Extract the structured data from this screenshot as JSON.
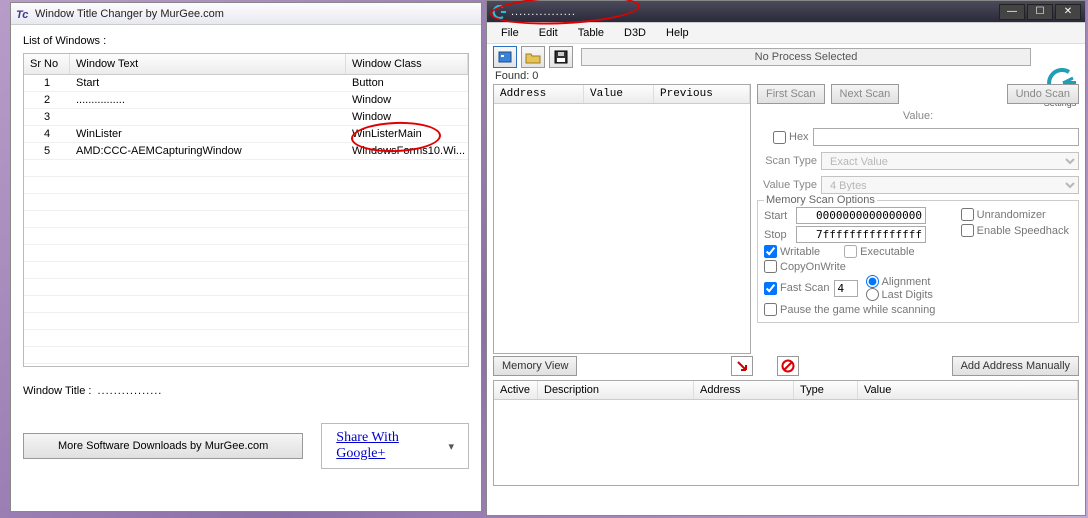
{
  "left": {
    "title": "Window Title Changer by MurGee.com",
    "listLabel": "List of Windows :",
    "headers": {
      "sr": "Sr No",
      "text": "Window Text",
      "cls": "Window Class"
    },
    "rows": [
      {
        "sr": "1",
        "text": "Start",
        "cls": "Button"
      },
      {
        "sr": "2",
        "text": "................",
        "cls": "Window"
      },
      {
        "sr": "3",
        "text": "",
        "cls": "Window"
      },
      {
        "sr": "4",
        "text": "WinLister",
        "cls": "WinListerMain"
      },
      {
        "sr": "5",
        "text": "AMD:CCC-AEMCapturingWindow",
        "cls": "WindowsForms10.Wi..."
      }
    ],
    "windowTitleLabel": "Window Title :",
    "windowTitleValue": "................",
    "moreBtn": "More Software Downloads by MurGee.com",
    "shareLink": "Share With Google+"
  },
  "right": {
    "title": "................",
    "menu": {
      "file": "File",
      "edit": "Edit",
      "table": "Table",
      "d3d": "D3D",
      "help": "Help"
    },
    "process": "No Process Selected",
    "settings": "Settings",
    "found": "Found: 0",
    "scanHead": {
      "addr": "Address",
      "val": "Value",
      "prev": "Previous"
    },
    "buttons": {
      "first": "First Scan",
      "next": "Next Scan",
      "undo": "Undo Scan",
      "memview": "Memory View",
      "addman": "Add Address Manually"
    },
    "labels": {
      "value": "Value:",
      "hex": "Hex",
      "scantype": "Scan Type",
      "valuetype": "Value Type",
      "memopts": "Memory Scan Options",
      "start": "Start",
      "stop": "Stop",
      "writable": "Writable",
      "exec": "Executable",
      "cow": "CopyOnWrite",
      "fastscan": "Fast Scan",
      "align": "Alignment",
      "lastd": "Last Digits",
      "pause": "Pause the game while scanning",
      "unrand": "Unrandomizer",
      "speed": "Enable Speedhack"
    },
    "values": {
      "scantype": "Exact Value",
      "valuetype": "4 Bytes",
      "start": "0000000000000000",
      "stop": "7fffffffffffffff",
      "fastscan": "4"
    },
    "addrHead": {
      "active": "Active",
      "desc": "Description",
      "addr": "Address",
      "type": "Type",
      "val": "Value"
    }
  }
}
